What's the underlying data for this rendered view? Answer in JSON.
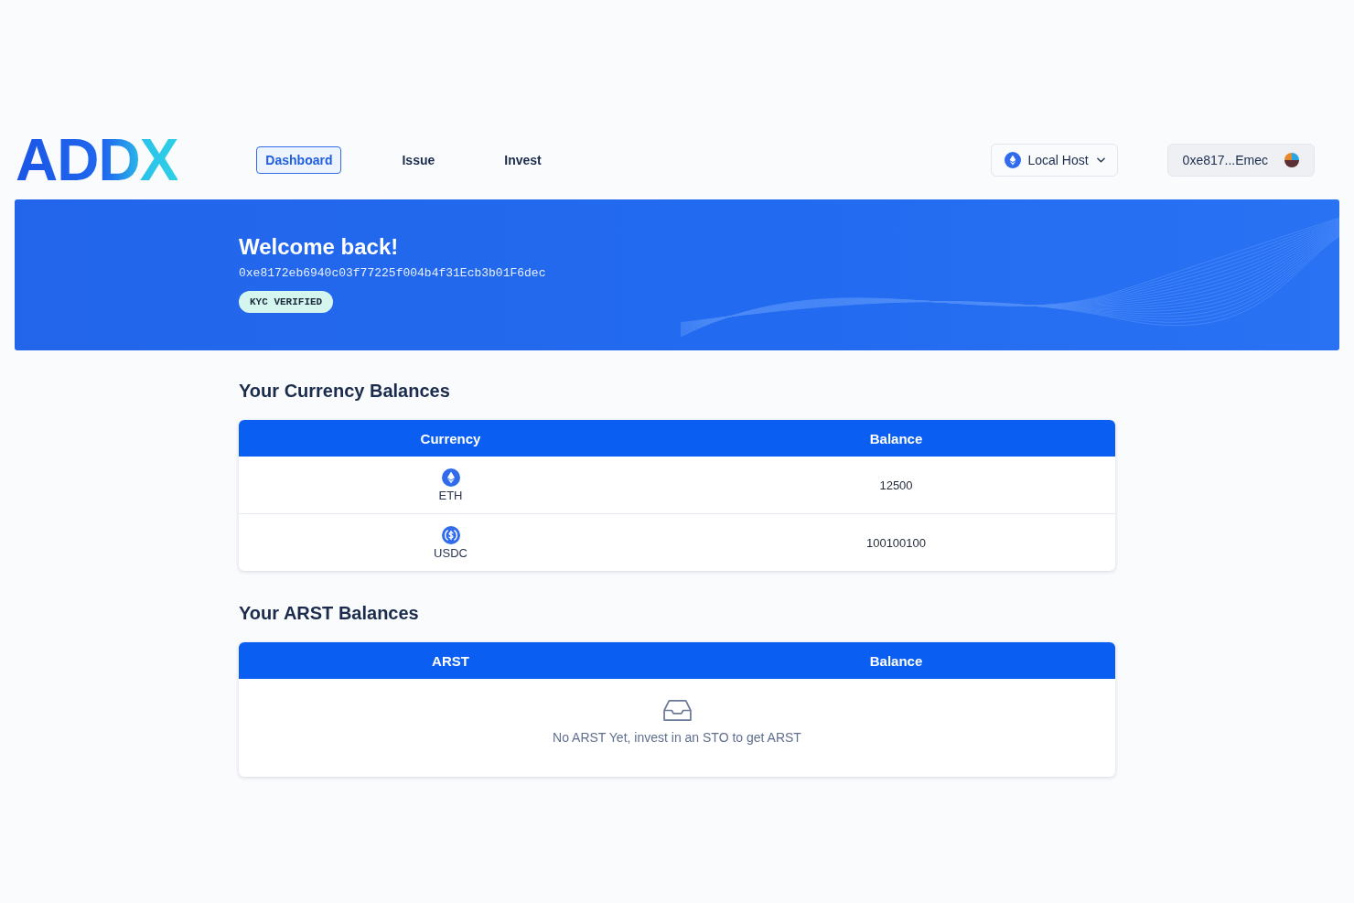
{
  "logo": {
    "text": "ADDX"
  },
  "nav": [
    {
      "label": "Dashboard",
      "selected": true
    },
    {
      "label": "Issue",
      "selected": false
    },
    {
      "label": "Invest",
      "selected": false
    }
  ],
  "network_selector": {
    "label": "Local Host"
  },
  "wallet_button": {
    "address": "0xe817...Emec"
  },
  "banner": {
    "title": "Welcome back!",
    "address": "0xe8172eb6940c03f77225f004b4f31Ecb3b01F6dec",
    "badge": "KYC VERIFIED"
  },
  "currency_balances": {
    "title": "Your Currency Balances",
    "columns": [
      "Currency",
      "Balance"
    ],
    "rows": [
      {
        "kind": "eth",
        "currency": "ETH",
        "balance": "12500"
      },
      {
        "kind": "usdc",
        "currency": "USDC",
        "balance": "100100100"
      }
    ]
  },
  "arst_balances": {
    "title": "Your ARST Balances",
    "columns": [
      "ARST",
      "Balance"
    ],
    "empty_message": "No ARST Yet, invest in an STO to get ARST"
  }
}
